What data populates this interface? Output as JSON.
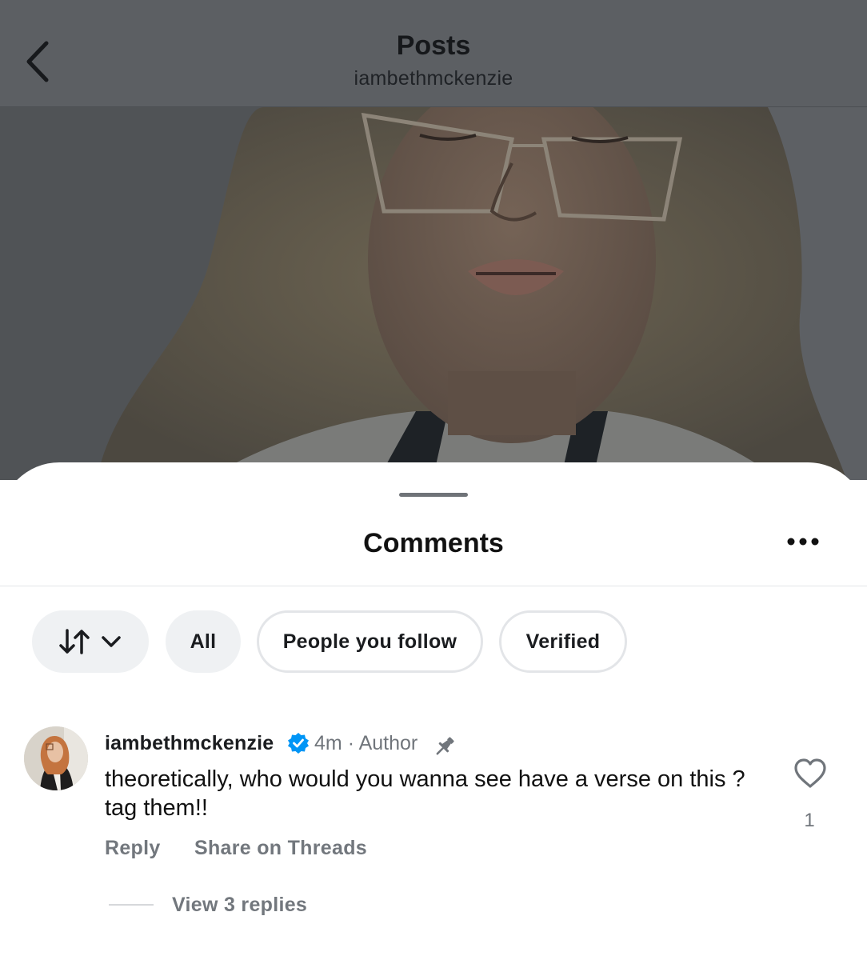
{
  "header": {
    "title": "Posts",
    "username": "iambethmckenzie"
  },
  "comments_sheet": {
    "title": "Comments",
    "filters": [
      {
        "label": "All",
        "style": "filled"
      },
      {
        "label": "People you follow",
        "style": "outline"
      },
      {
        "label": "Verified",
        "style": "outline"
      }
    ]
  },
  "comment": {
    "username": "iambethmckenzie",
    "verified": true,
    "time": "4m",
    "separator": "·",
    "role": "Author",
    "pinned": true,
    "text": "theoretically, who would you wanna see have a verse on this ? tag them!!",
    "likes": "1",
    "reply_label": "Reply",
    "share_label": "Share on Threads",
    "view_replies_label": "View 3 replies"
  },
  "icons": {
    "back": "chevron-left-icon",
    "more": "more-horizontal-icon",
    "sort": "sort-arrows-icon",
    "sort_dropdown": "chevron-down-icon",
    "verified": "verified-badge-icon",
    "pin": "pin-icon",
    "like": "heart-icon"
  },
  "colors": {
    "verified_blue": "#0095f6",
    "secondary_text": "#72777d",
    "overlay_dim": "#5c5f63"
  }
}
